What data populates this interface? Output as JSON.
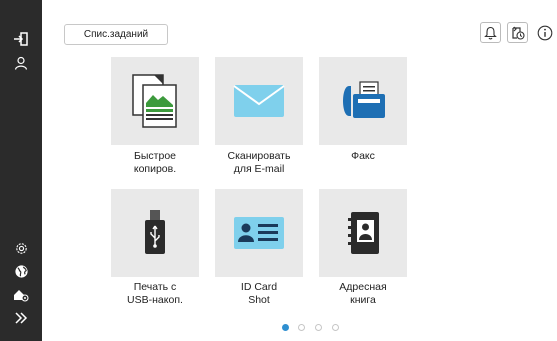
{
  "header": {
    "job_list_label": "Спис.заданий",
    "icons": [
      "bell-icon",
      "box-icon",
      "info-icon"
    ]
  },
  "sidebar": {
    "icons": [
      "login-icon",
      "user-icon",
      "gear-icon",
      "globe-icon",
      "user-settings-icon",
      "expand-icon"
    ]
  },
  "functions": [
    {
      "line1": "Быстрое",
      "line2": "копиров.",
      "icon": "copy-icon"
    },
    {
      "line1": "Сканировать",
      "line2": "для E-mail",
      "icon": "envelope-icon"
    },
    {
      "line1": "Факс",
      "line2": "",
      "icon": "fax-icon"
    },
    {
      "line1": "Печать с",
      "line2": "USB-накоп.",
      "icon": "usb-icon"
    },
    {
      "line1": "ID Card",
      "line2": "Shot",
      "icon": "id-card-icon"
    },
    {
      "line1": "Адресная",
      "line2": "книга",
      "icon": "address-book-icon"
    }
  ],
  "pagination": {
    "total_pages": 4,
    "current_page": 1
  },
  "colors": {
    "sidebar": "#2b2b2b",
    "tile": "#e9e9e9",
    "accent": "#2f8fd0",
    "envelope": "#7fd0ec",
    "fax": "#1e6fb4"
  }
}
